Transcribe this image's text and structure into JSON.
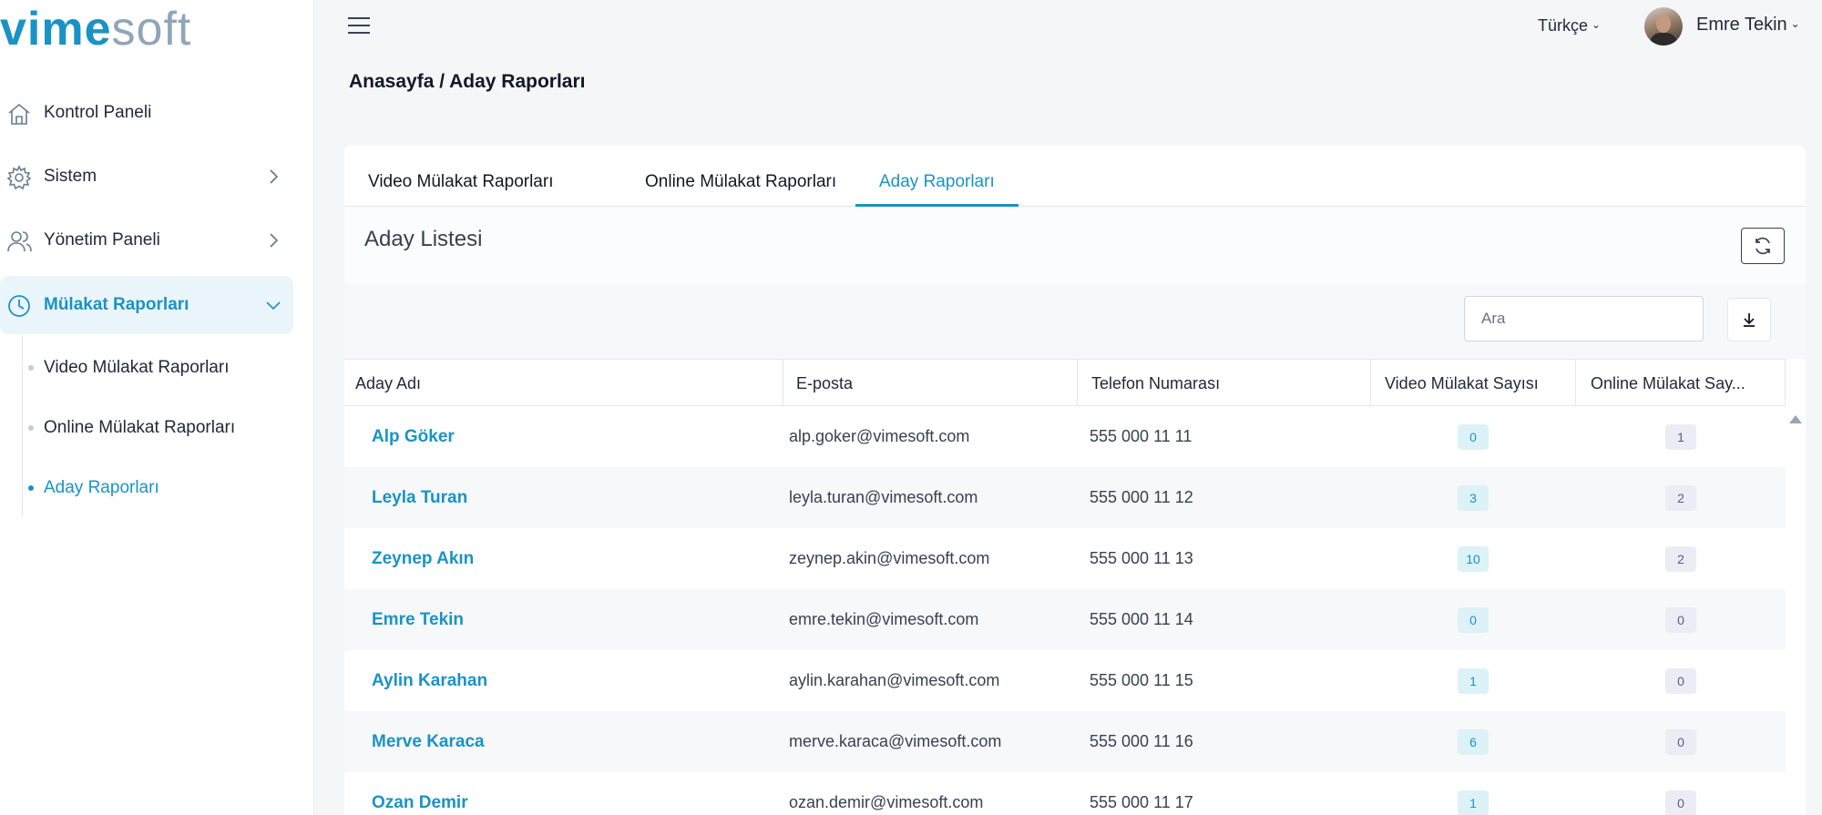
{
  "brand": {
    "bold": "vime",
    "light": "soft"
  },
  "sidebar": {
    "items": [
      {
        "label": "Kontrol Paneli",
        "icon": "home-icon"
      },
      {
        "label": "Sistem",
        "icon": "gear-icon"
      },
      {
        "label": "Yönetim Paneli",
        "icon": "users-icon"
      },
      {
        "label": "Mülakat Raporları",
        "icon": "clock-icon"
      }
    ],
    "sub_items": [
      {
        "label": "Video Mülakat Raporları"
      },
      {
        "label": "Online Mülakat Raporları"
      },
      {
        "label": "Aday Raporları"
      }
    ]
  },
  "topbar": {
    "language": "Türkçe",
    "user_name": "Emre Tekin"
  },
  "breadcrumb": "Anasayfa / Aday Raporları",
  "tabs": [
    {
      "label": "Video Mülakat Raporları"
    },
    {
      "label": "Online Mülakat Raporları"
    },
    {
      "label": "Aday Raporları"
    }
  ],
  "list": {
    "title": "Aday Listesi",
    "search_placeholder": "Ara"
  },
  "table": {
    "columns": [
      "Aday Adı",
      "E-posta",
      "Telefon Numarası",
      "Video Mülakat Sayısı",
      "Online Mülakat Say..."
    ],
    "rows": [
      {
        "name": "Alp Göker",
        "email": "alp.goker@vimesoft.com",
        "phone": "555 000 11 11",
        "video": "0",
        "online": "1"
      },
      {
        "name": "Leyla Turan",
        "email": "leyla.turan@vimesoft.com",
        "phone": "555 000 11 12",
        "video": "3",
        "online": "2"
      },
      {
        "name": "Zeynep Akın",
        "email": "zeynep.akin@vimesoft.com",
        "phone": "555 000 11 13",
        "video": "10",
        "online": "2"
      },
      {
        "name": "Emre Tekin",
        "email": "emre.tekin@vimesoft.com",
        "phone": "555 000 11 14",
        "video": "0",
        "online": "0"
      },
      {
        "name": "Aylin Karahan",
        "email": "aylin.karahan@vimesoft.com",
        "phone": "555 000 11 15",
        "video": "1",
        "online": "0"
      },
      {
        "name": "Merve Karaca",
        "email": "merve.karaca@vimesoft.com",
        "phone": "555 000 11 16",
        "video": "6",
        "online": "0"
      },
      {
        "name": "Ozan Demir",
        "email": "ozan.demir@vimesoft.com",
        "phone": "555 000 11 17",
        "video": "1",
        "online": "0"
      }
    ]
  },
  "colors": {
    "accent": "#1a93c4",
    "sidebar_active_bg": "#eaf5fb"
  }
}
